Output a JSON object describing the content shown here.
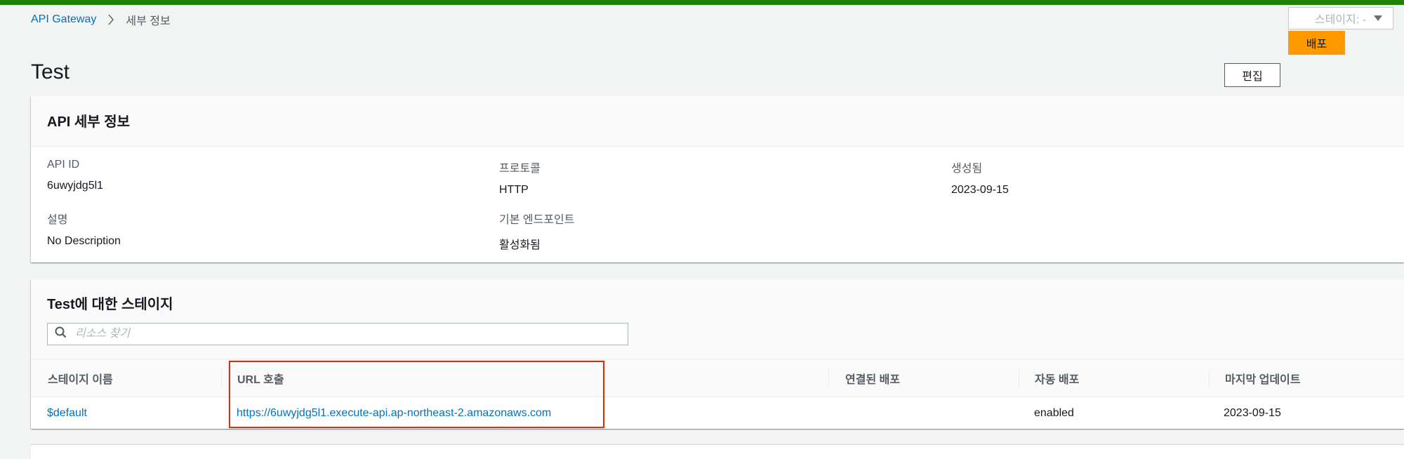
{
  "colors": {
    "status_bar": "#1d8102",
    "link": "#0073bb",
    "primary": "#ff9900",
    "highlight": "#d13212"
  },
  "breadcrumb": {
    "root": "API Gateway",
    "current": "세부 정보",
    "separator_icon": "chevron-right-icon"
  },
  "header": {
    "stage_select": "스테이지: -",
    "deploy_label": "배포",
    "title": "Test",
    "edit_label": "편집"
  },
  "details": {
    "title": "API 세부 정보",
    "fields": {
      "api_id": {
        "label": "API ID",
        "value": "6uwyjdg5l1"
      },
      "protocol": {
        "label": "프로토콜",
        "value": "HTTP"
      },
      "created": {
        "label": "생성됨",
        "value": "2023-09-15"
      },
      "description": {
        "label": "설명",
        "value": "No Description"
      },
      "default_endpoint": {
        "label": "기본 엔드포인트",
        "value": "활성화됨"
      }
    }
  },
  "stages": {
    "title": "Test에 대한 스테이지",
    "search": {
      "placeholder": "리소스 찾기",
      "value": "",
      "icon": "search-icon"
    },
    "columns": [
      "스테이지 이름",
      "URL 호출",
      "연결된 배포",
      "자동 배포",
      "마지막 업데이트"
    ],
    "rows": [
      {
        "name": "$default",
        "url": "https://6uwyjdg5l1.execute-api.ap-northeast-2.amazonaws.com",
        "deployment": "",
        "auto_deploy": "enabled",
        "last_updated": "2023-09-15"
      }
    ]
  }
}
